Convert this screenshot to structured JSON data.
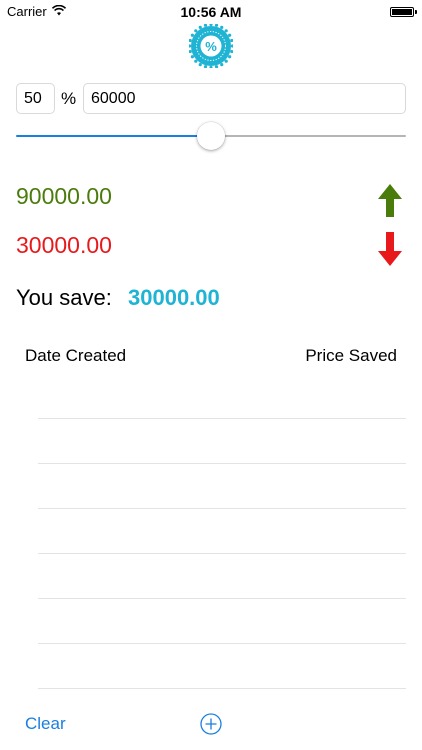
{
  "status_bar": {
    "carrier": "Carrier",
    "time": "10:56 AM"
  },
  "logo": {
    "icon": "percent-badge-icon",
    "glyph": "%",
    "color": "#1fb3d4"
  },
  "calculator": {
    "percent_value": "50",
    "percent_symbol": "%",
    "amount_value": "60000",
    "slider_level": 0.5,
    "high_value": "90000.00",
    "low_value": "30000.00",
    "high_color": "#4a7c0c",
    "low_color": "#e8191b",
    "save_label": "You save:",
    "save_value": "30000.00",
    "save_color": "#1fb3d4",
    "up_icon": "arrow-up-icon",
    "down_icon": "arrow-down-icon"
  },
  "history": {
    "columns": [
      "Date Created",
      "Price Saved"
    ],
    "rows": [
      "",
      "",
      "",
      "",
      "",
      "",
      ""
    ]
  },
  "footer": {
    "clear_label": "Clear",
    "add_icon": "plus-circle-icon",
    "accent": "#1a7fe0"
  }
}
